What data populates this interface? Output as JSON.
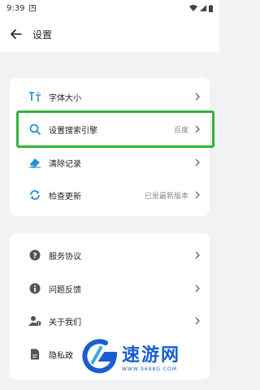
{
  "status_bar": {
    "time": "9:39",
    "notif_letter": "A"
  },
  "header": {
    "title": "设置"
  },
  "section1": {
    "items": [
      {
        "label": "字体大小",
        "value": ""
      },
      {
        "label": "设置搜索引擎",
        "value": "百度"
      },
      {
        "label": "清除记录",
        "value": ""
      },
      {
        "label": "检查更新",
        "value": "已是最新版本"
      }
    ]
  },
  "section2": {
    "items": [
      {
        "label": "服务协议"
      },
      {
        "label": "问题反馈"
      },
      {
        "label": "关于我们"
      },
      {
        "label": "隐私政"
      }
    ]
  },
  "watermark": {
    "text": "速游网",
    "url": "WWW.9688G.COM"
  },
  "colors": {
    "accent": "#2a8fd4",
    "highlight": "#33b33a",
    "background": "#f2f2f4"
  }
}
